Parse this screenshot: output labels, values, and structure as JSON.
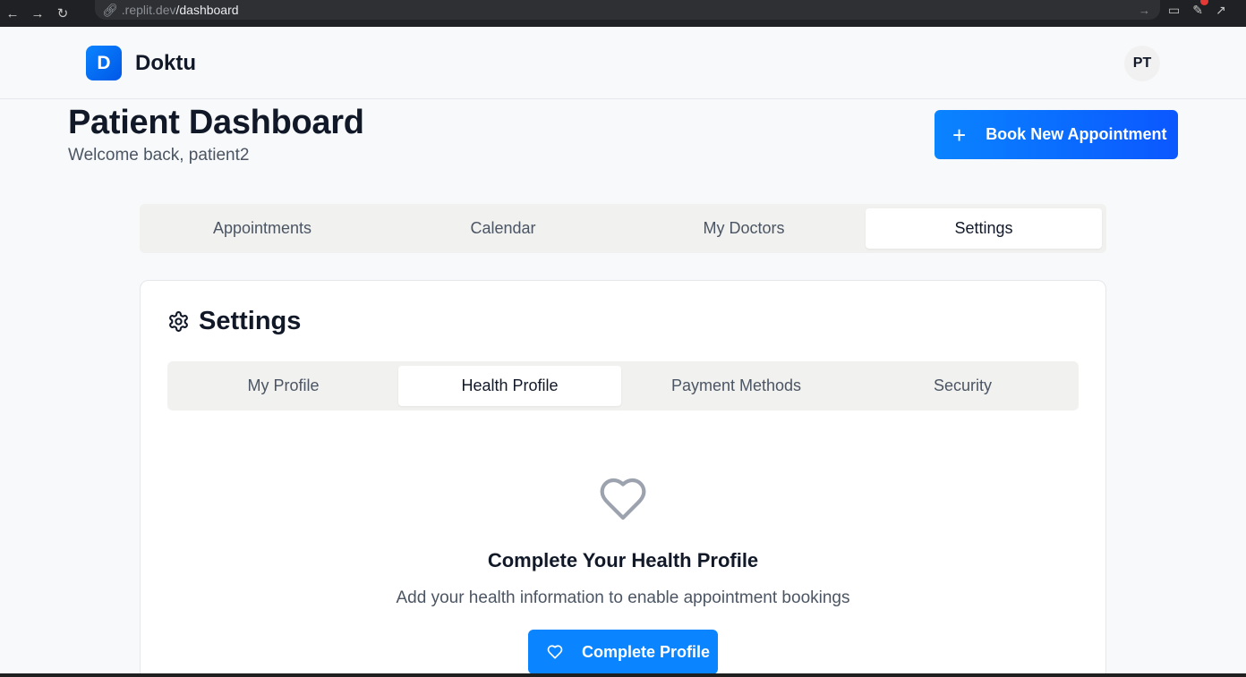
{
  "browser": {
    "url_prefix": ".replit.dev",
    "url_path": "/dashboard"
  },
  "header": {
    "logo_letter": "D",
    "app_name": "Doktu",
    "avatar_initials": "PT"
  },
  "page": {
    "title": "Patient Dashboard",
    "subtitle": "Welcome back, patient2",
    "book_button": "Book New Appointment"
  },
  "main_tabs": [
    {
      "label": "Appointments",
      "active": false
    },
    {
      "label": "Calendar",
      "active": false
    },
    {
      "label": "My Doctors",
      "active": false
    },
    {
      "label": "Settings",
      "active": true
    }
  ],
  "settings": {
    "title": "Settings",
    "tabs": [
      {
        "label": "My Profile",
        "active": false
      },
      {
        "label": "Health Profile",
        "active": true
      },
      {
        "label": "Payment Methods",
        "active": false
      },
      {
        "label": "Security",
        "active": false
      }
    ],
    "empty_state": {
      "icon": "heart-icon",
      "title": "Complete Your Health Profile",
      "description": "Add your health information to enable appointment bookings",
      "button": "Complete Profile"
    }
  },
  "colors": {
    "primary": "#0a84ff",
    "background": "#f8f9fa",
    "tab_track": "#f1f1ef"
  }
}
